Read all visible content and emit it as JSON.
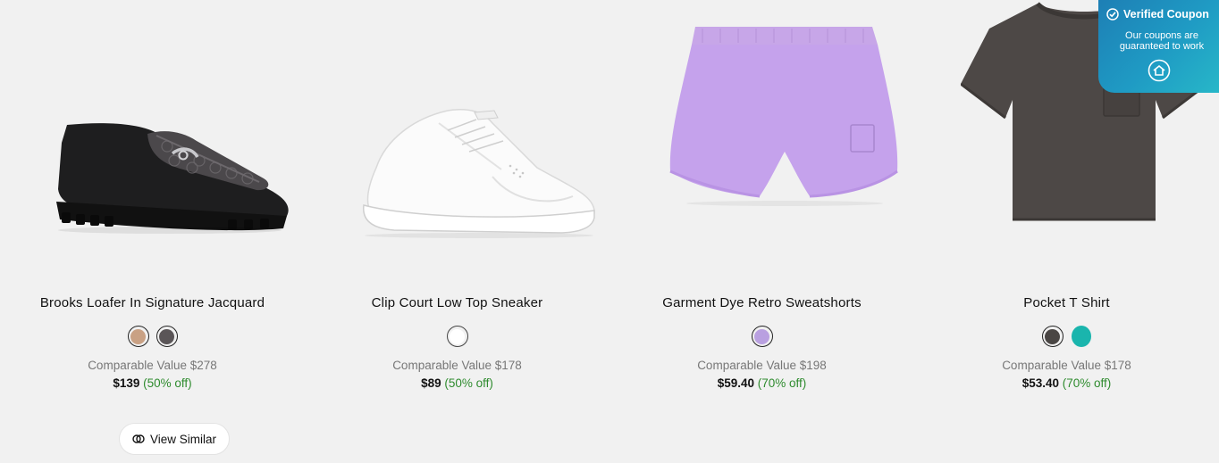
{
  "products": [
    {
      "name": "Brooks Loafer In Signature Jacquard",
      "swatch_colors": [
        "#c9a184",
        "#5a5557"
      ],
      "comparable_label": "Comparable Value $278",
      "price": "$139",
      "discount": "(50% off)"
    },
    {
      "name": "Clip Court Low Top Sneaker",
      "swatch_colors": [
        "#ffffff"
      ],
      "comparable_label": "Comparable Value $178",
      "price": "$89",
      "discount": "(50% off)"
    },
    {
      "name": "Garment Dye Retro Sweatshorts",
      "swatch_colors": [
        "#b9a0e0"
      ],
      "comparable_label": "Comparable Value $198",
      "price": "$59.40",
      "discount": "(70% off)"
    },
    {
      "name": "Pocket T Shirt",
      "swatch_colors": [
        "#4a4644",
        "#1ab5ad"
      ],
      "comparable_label": "Comparable Value $178",
      "price": "$53.40",
      "discount": "(70% off)"
    }
  ],
  "view_similar": {
    "label": "View Similar",
    "icon": "view-similar-icon"
  },
  "coupon": {
    "title": "Verified Coupon",
    "line1": "Our coupons are",
    "line2": "guaranteed to work",
    "icon": "check-badge-icon"
  },
  "colors": {
    "page_bg": "#f1f1f1",
    "discount_green": "#2e8b2e",
    "coupon_blue": "#1f9bc4"
  }
}
